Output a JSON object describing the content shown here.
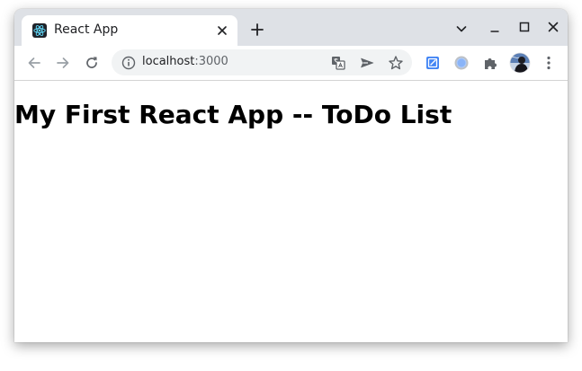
{
  "browser": {
    "tab": {
      "title": "React App",
      "favicon": "react-logo-icon"
    },
    "address_bar": {
      "host": "localhost",
      "port": ":3000"
    },
    "icons": {
      "back": "back-arrow-icon",
      "forward": "forward-arrow-icon",
      "reload": "reload-icon",
      "site_info": "info-icon",
      "translate": "translate-icon",
      "send": "send-icon",
      "bookmark": "star-icon",
      "extensions": "puzzle-icon",
      "menu": "kebab-menu-icon"
    },
    "colors": {
      "titlebar": "#dee1e6",
      "tab_active": "#ffffff",
      "omnibox": "#f1f3f4",
      "react_blue": "#61dafb"
    }
  },
  "page": {
    "heading": "My First React App -- ToDo List"
  }
}
